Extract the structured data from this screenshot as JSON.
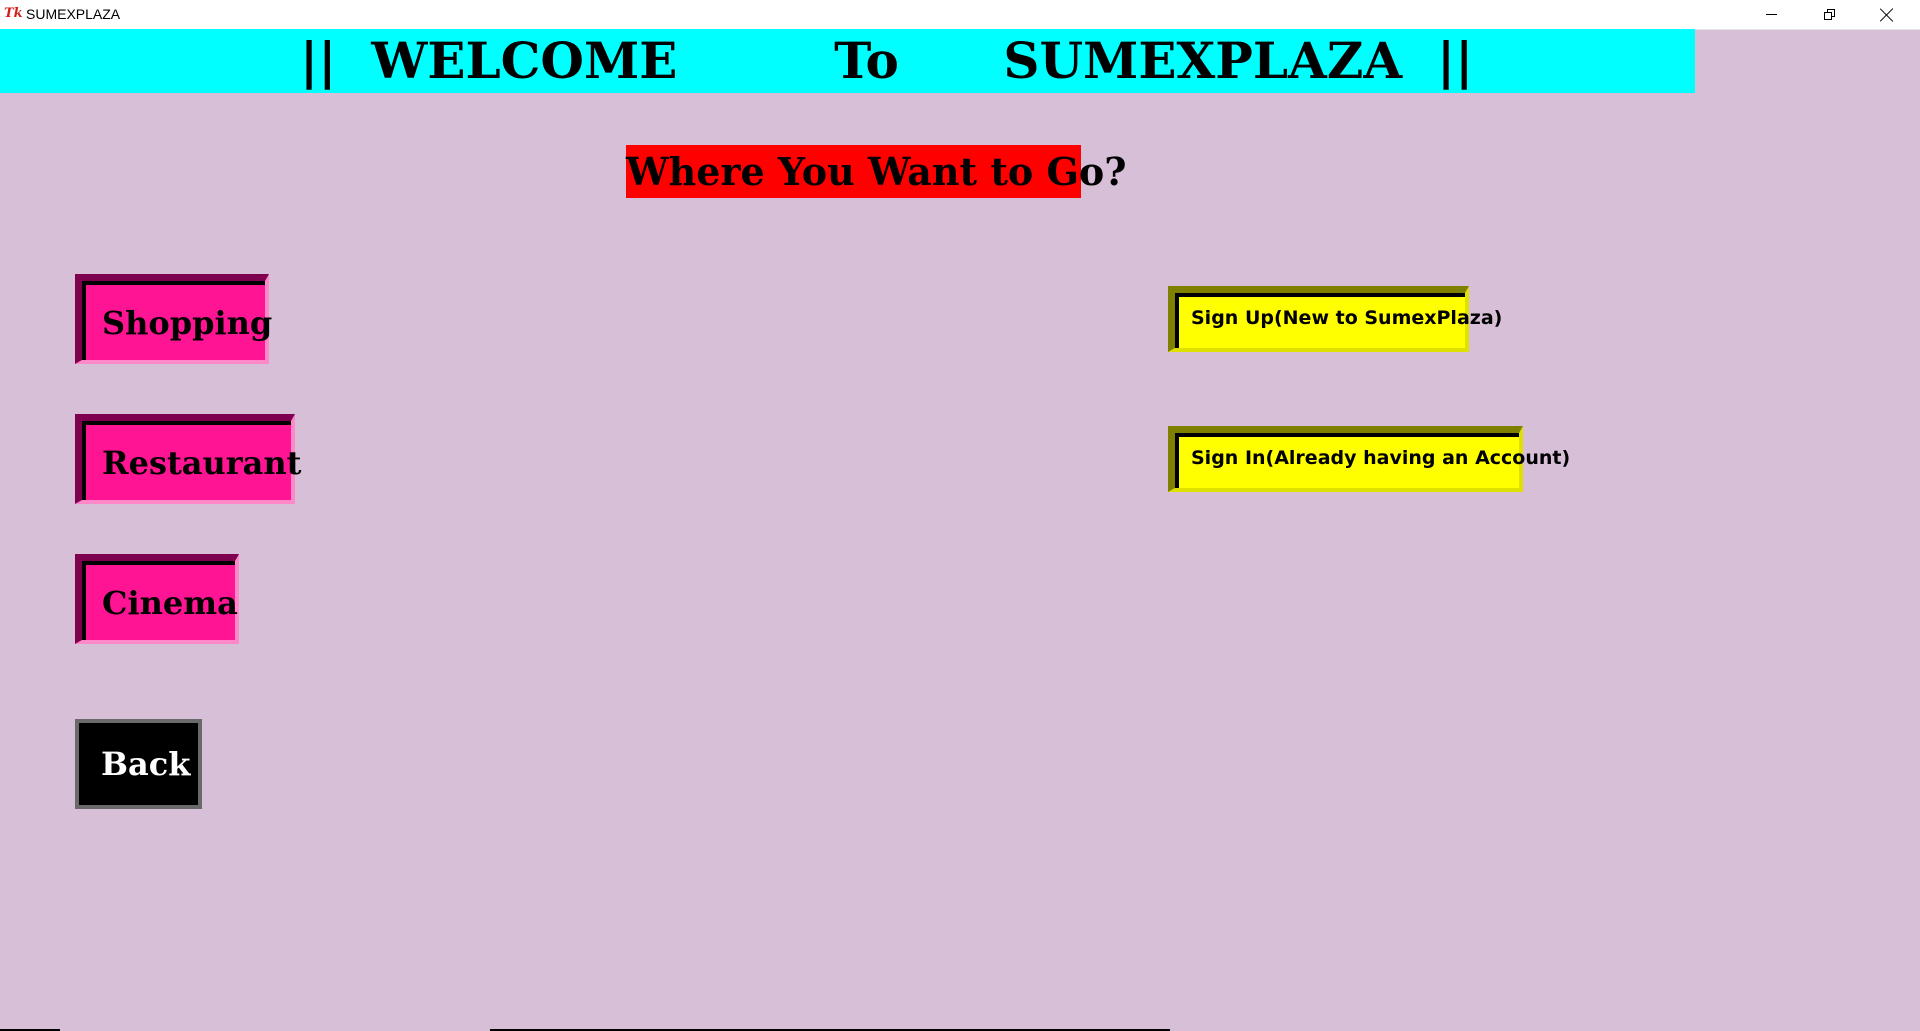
{
  "window": {
    "title": "SUMEXPLAZA",
    "logo_icon": "tk-feather-icon"
  },
  "banner": {
    "text": "||  WELCOME         To      SUMEXPLAZA  ||"
  },
  "question": "Where You Want to Go?",
  "buttons": {
    "shopping": "Shopping",
    "restaurant": "Restaurant",
    "cinema": "Cinema",
    "back": "Back",
    "signup": "Sign Up(New to SumexPlaza)",
    "signin": "Sign In(Already having an Account)"
  },
  "colors": {
    "background": "#d8bfd8",
    "banner": "#00ffff",
    "question_bg": "#ff0000",
    "nav_button": "#ff1493",
    "account_button": "#ffff00",
    "back_button": "#000000"
  }
}
